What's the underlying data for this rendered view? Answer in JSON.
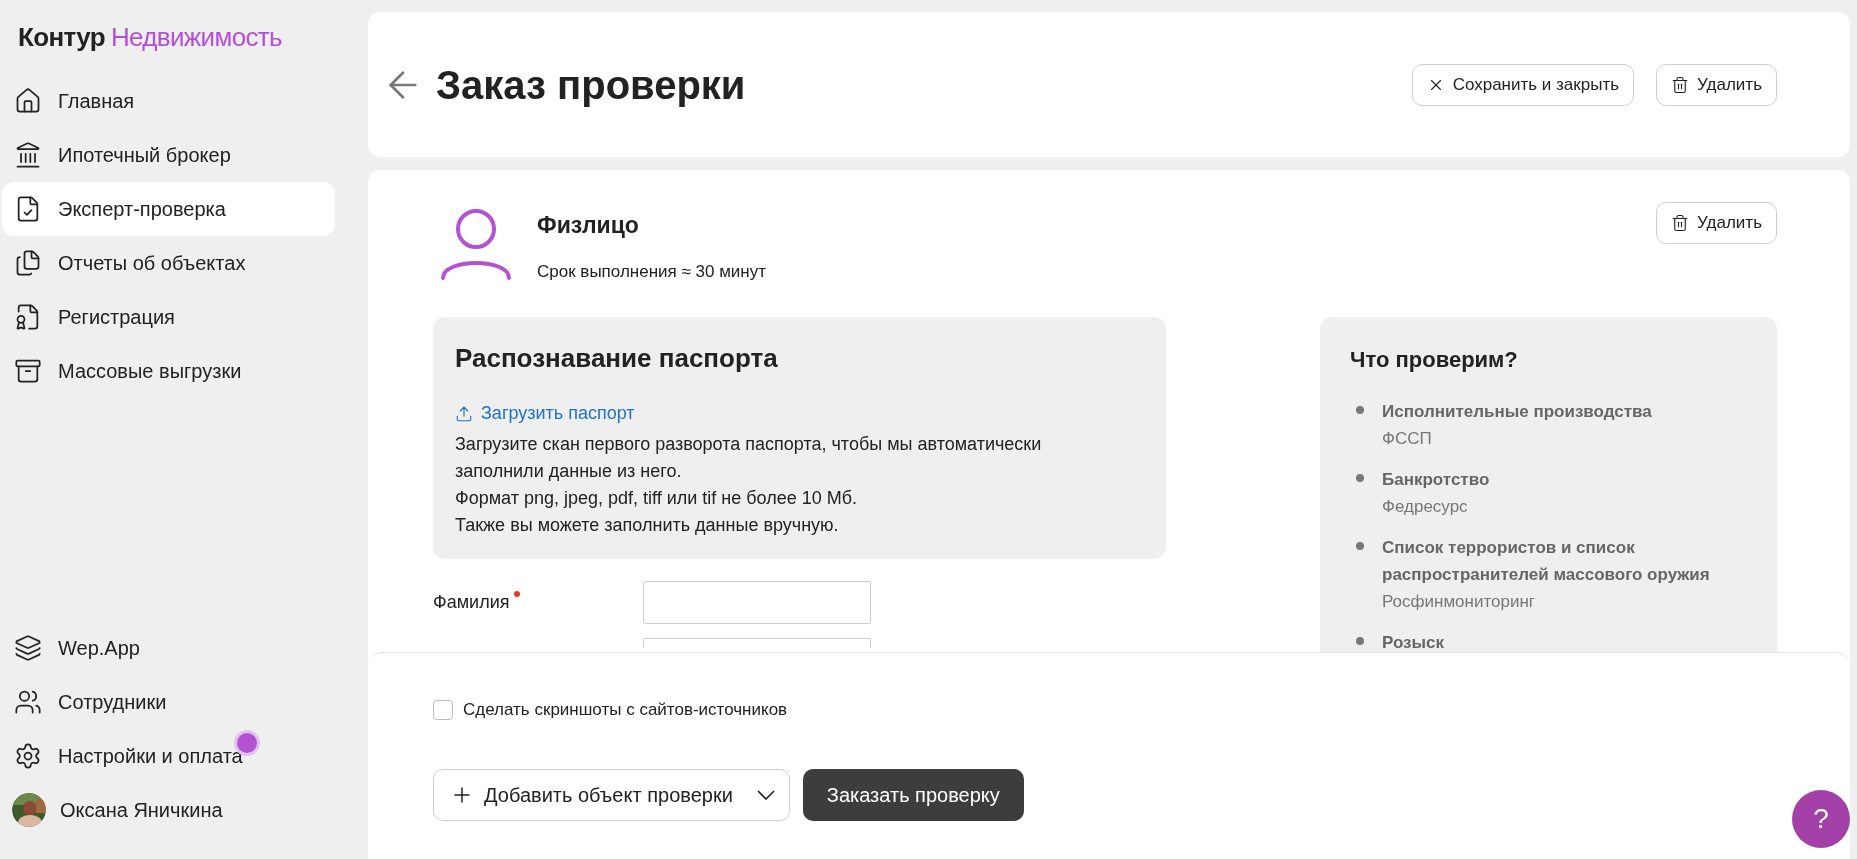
{
  "logo": {
    "brand": "Контур",
    "product": "Недвижимость"
  },
  "sidebar": {
    "items": [
      {
        "label": "Главная",
        "selected": false
      },
      {
        "label": "Ипотечный брокер",
        "selected": false
      },
      {
        "label": "Эксперт-проверка",
        "selected": true
      },
      {
        "label": "Отчеты об объектах",
        "selected": false
      },
      {
        "label": "Регистрация",
        "selected": false
      },
      {
        "label": "Массовые выгрузки",
        "selected": false
      }
    ],
    "bottom_items": [
      {
        "label": "Wep.App",
        "notification": false
      },
      {
        "label": "Сотрудники",
        "notification": false
      },
      {
        "label": "Настройки и оплата",
        "notification": true
      }
    ],
    "user": {
      "name": "Оксана Яничкина"
    }
  },
  "header": {
    "title": "Заказ проверки",
    "buttons": [
      "Сохранить и закрыть",
      "Удалить"
    ]
  },
  "subject": {
    "title": "Физлицо",
    "subtitle": "Срок выполнения ≈ 30 минут",
    "delete_button": "Удалить"
  },
  "passport": {
    "title": "Распознавание паспорта",
    "link": "Загрузить паспорт",
    "lines": [
      "Загрузите скан первого разворота паспорта, чтобы мы автоматически заполнили данные из него.",
      "Формат png, jpeg, pdf, tiff или tif не более 10 Мб.",
      "Также вы можете заполнить данные вручную."
    ]
  },
  "form": {
    "fields": [
      {
        "label": "Фамилия",
        "required": true
      }
    ]
  },
  "checks": {
    "title": "Что проверим?",
    "items": [
      {
        "name": "Исполнительные производства",
        "source": "ФССП"
      },
      {
        "name": "Банкротство",
        "source": "Федресурс"
      },
      {
        "name": "Список террористов и список распространителей массового оружия",
        "source": "Росфинмониторинг"
      },
      {
        "name": "Розыск"
      }
    ]
  },
  "footer": {
    "screenshots": {
      "label": "Сделать скриншоты с сайтов-источников",
      "checked": false
    },
    "add_button": "Добавить объект проверки",
    "order_button": "Заказать проверку"
  },
  "help": {
    "label": "?"
  }
}
